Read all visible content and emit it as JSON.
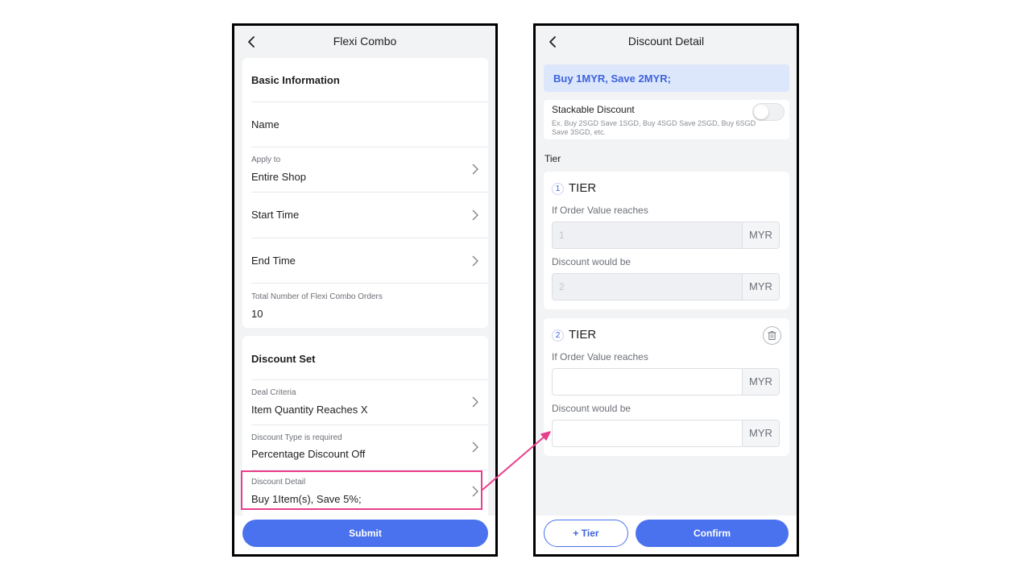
{
  "left": {
    "title": "Flexi Combo",
    "basic_info": {
      "heading": "Basic Information",
      "name_label": "Name",
      "apply_to_label": "Apply to",
      "apply_to_value": "Entire Shop",
      "start_time_label": "Start Time",
      "end_time_label": "End Time",
      "total_orders_label": "Total Number of Flexi Combo Orders",
      "total_orders_value": "10"
    },
    "discount_set": {
      "heading": "Discount Set",
      "deal_criteria_label": "Deal Criteria",
      "deal_criteria_value": "Item Quantity Reaches X",
      "discount_type_label": "Discount Type is required",
      "discount_type_value": "Percentage Discount Off",
      "discount_detail_label": "Discount Detail",
      "discount_detail_value": "Buy 1Item(s), Save 5%;"
    },
    "submit_label": "Submit"
  },
  "right": {
    "title": "Discount Detail",
    "banner": "Buy 1MYR, Save 2MYR;",
    "stackable": {
      "label": "Stackable Discount",
      "hint": "Ex. Buy 2SGD Save 1SGD, Buy 4SGD Save 2SGD, Buy 6SGD Save 3SGD, etc.",
      "enabled": false
    },
    "tier_section_label": "Tier",
    "tiers": [
      {
        "number": "1",
        "label": "TIER",
        "order_value_label": "If Order Value reaches",
        "order_value": "1",
        "discount_label": "Discount would be",
        "discount_value": "2",
        "unit": "MYR"
      },
      {
        "number": "2",
        "label": "TIER",
        "order_value_label": "If Order Value reaches",
        "order_value": "",
        "discount_label": "Discount would be",
        "discount_value": "",
        "unit": "MYR"
      }
    ],
    "add_tier_label": "+ Tier",
    "confirm_label": "Confirm"
  },
  "colors": {
    "accent": "#4a72ef",
    "highlight": "#e83e8c",
    "banner_bg": "#dde7fb"
  }
}
